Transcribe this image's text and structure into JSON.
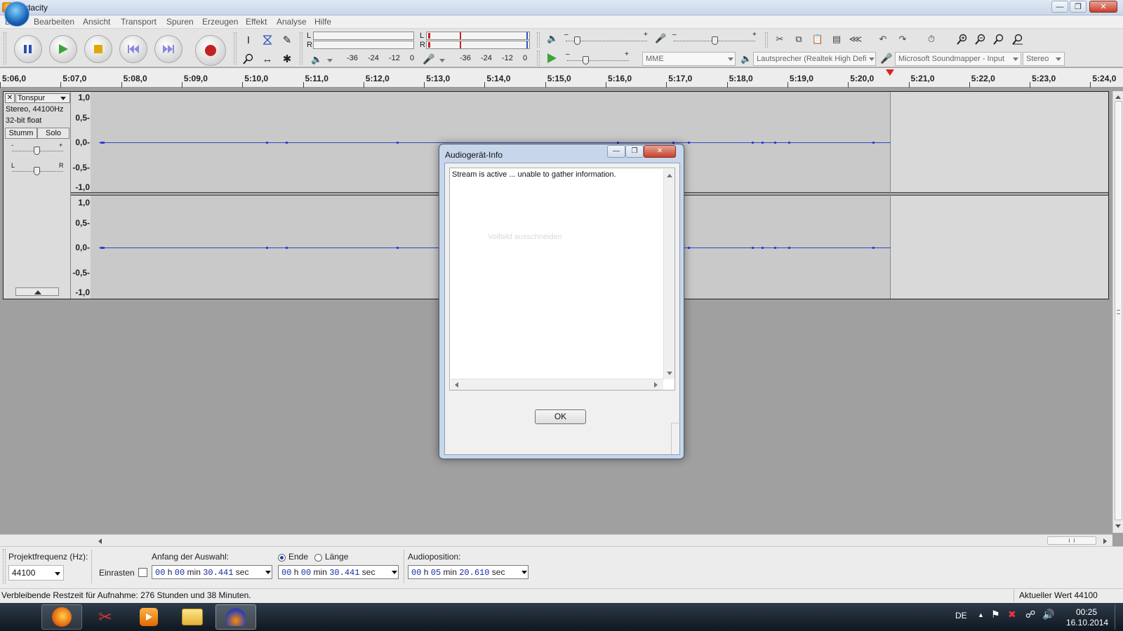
{
  "window": {
    "title": "Audacity",
    "icon": "audacity-icon"
  },
  "menu": [
    "Datei",
    "Bearbeiten",
    "Ansicht",
    "Transport",
    "Spuren",
    "Erzeugen",
    "Effekt",
    "Analyse",
    "Hilfe"
  ],
  "meters": {
    "playback": {
      "L": "L",
      "R": "R",
      "scale": [
        "-36",
        "-24",
        "-12",
        "0"
      ]
    },
    "record": {
      "L": "L",
      "R": "R",
      "scale": [
        "-36",
        "-24",
        "-12",
        "0"
      ]
    }
  },
  "device": {
    "host": "MME",
    "output": "Lautsprecher (Realtek High Defi",
    "input": "Microsoft Soundmapper - Input",
    "channels": "Stereo"
  },
  "ruler": {
    "labels": [
      "5:06,0",
      "5:07,0",
      "5:08,0",
      "5:09,0",
      "5:10,0",
      "5:11,0",
      "5:12,0",
      "5:13,0",
      "5:14,0",
      "5:15,0",
      "5:16,0",
      "5:17,0",
      "5:18,0",
      "5:19,0",
      "5:20,0",
      "5:21,0",
      "5:22,0",
      "5:23,0",
      "5:24,0"
    ]
  },
  "track": {
    "close": "✕",
    "name": "Tonspur",
    "info1": "Stereo, 44100Hz",
    "info2": "32-bit float",
    "mute": "Stumm",
    "solo": "Solo",
    "gain_minus": "-",
    "gain_plus": "+",
    "pan_left": "L",
    "pan_right": "R",
    "scale": [
      "1,0",
      "0,5-",
      "0,0-",
      "-0,5-",
      "-1,0"
    ]
  },
  "selection": {
    "rate_label": "Projektfrequenz (Hz):",
    "rate_value": "44100",
    "snap_label": "Einrasten",
    "start_label": "Anfang der Auswahl:",
    "end_label": "Ende",
    "length_label": "Länge",
    "start": {
      "h": "00",
      "m": "00",
      "s": "30.441"
    },
    "end": {
      "h": "00",
      "m": "00",
      "s": "30.441"
    },
    "position_label": "Audioposition:",
    "position": {
      "h": "00",
      "m": "05",
      "s": "20.610"
    },
    "units": {
      "h": "h",
      "m": "min",
      "s": "sec"
    }
  },
  "status": {
    "left": "Verbleibende Restzeit für Aufnahme: 276 Stunden und 38 Minuten.",
    "right": "Aktueller Wert 44100"
  },
  "dialog": {
    "title": "Audiogerät-Info",
    "text": "Stream is active ... unable to gather information.",
    "ghost": "Vollbild ausschneiden",
    "ok": "OK"
  },
  "taskbar": {
    "apps": [
      "firefox-icon",
      "snipping-tool-icon",
      "media-player-icon",
      "file-explorer-icon",
      "audacity-icon"
    ],
    "lang": "DE",
    "time": "00:25",
    "date": "16.10.2014"
  }
}
